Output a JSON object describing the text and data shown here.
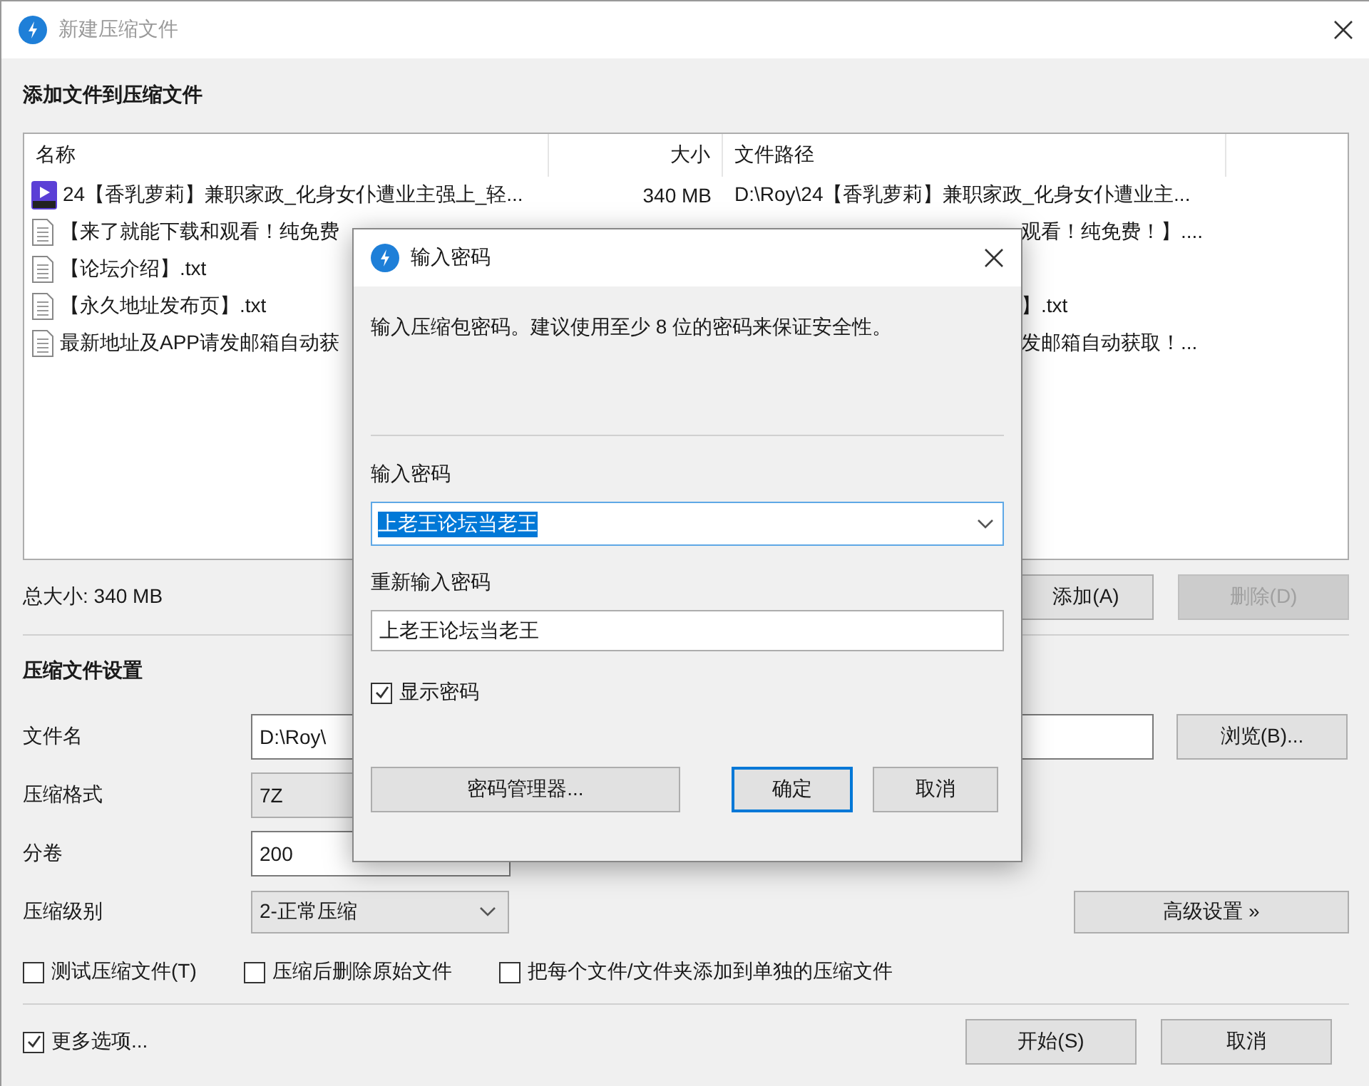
{
  "main_window": {
    "title": "新建压缩文件",
    "files_heading": "添加文件到压缩文件",
    "file_list": {
      "columns": [
        "名称",
        "大小",
        "文件路径"
      ],
      "rows": [
        {
          "kind": "video",
          "name": "24【香乳萝莉】兼职家政_化身女仆遭业主强上_轻...",
          "size": "340 MB",
          "path": "D:\\Roy\\24【香乳萝莉】兼职家政_化身女仆遭业主...",
          "covered": false
        },
        {
          "kind": "text",
          "name": "【来了就能下载和观看！纯免费",
          "path": "观看！纯免费！】....",
          "covered": true
        },
        {
          "kind": "text",
          "name": "【论坛介绍】.txt"
        },
        {
          "kind": "text",
          "name": "【永久地址发布页】.txt",
          "path": "】.txt",
          "covered": true
        },
        {
          "kind": "text",
          "name": "最新地址及APP请发邮箱自动获",
          "path": "发邮箱自动获取！...",
          "covered": true
        }
      ]
    },
    "total_size": "总大小: 340 MB",
    "list_buttons": [
      {
        "label": "添加(A)",
        "disabled": false
      },
      {
        "label": "删除(D)",
        "disabled": true
      }
    ],
    "settings_heading": "压缩文件设置",
    "settings": [
      {
        "kind": "text",
        "label": "文件名",
        "value": "D:\\Roy\\"
      },
      {
        "kind": "select",
        "label": "压缩格式",
        "value": "7Z"
      },
      {
        "kind": "text",
        "label": "分卷",
        "value": "200"
      },
      {
        "kind": "select",
        "label": "压缩级别",
        "value": "2-正常压缩"
      }
    ],
    "browse_button": "浏览(B)...",
    "advanced_button": "高级设置 »",
    "options": [
      {
        "label": "测试压缩文件(T)",
        "checked": false
      },
      {
        "label": "压缩后删除原始文件",
        "checked": false
      },
      {
        "label": "把每个文件/文件夹添加到单独的压缩文件",
        "checked": false
      }
    ],
    "more_options": {
      "label": "更多选项...",
      "checked": true
    },
    "bottom_buttons": [
      "开始(S)",
      "取消"
    ]
  },
  "password_dialog": {
    "title": "输入密码",
    "description": "输入压缩包密码。建议使用至少 8 位的密码来保证安全性。",
    "password_label": "输入密码",
    "password": {
      "value": "上老王论坛当老王",
      "text_selected": true
    },
    "confirm_label": "重新输入密码",
    "confirm": {
      "value": "上老王论坛当老王"
    },
    "show_password": {
      "label": "显示密码",
      "checked": true
    },
    "buttons": [
      {
        "label": "密码管理器...",
        "default": false
      },
      {
        "label": "确定",
        "default": true
      },
      {
        "label": "取消",
        "default": false
      }
    ]
  }
}
